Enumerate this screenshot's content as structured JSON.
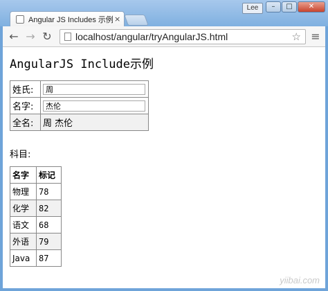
{
  "browser": {
    "tab_title": "Angular JS Includes 示例",
    "tab_close": "×",
    "user_badge": "Lee",
    "url": "localhost/angular/tryAngularJS.html"
  },
  "page": {
    "title": "AngularJS Include示例",
    "form": {
      "first_name_label": "姓氏:",
      "first_name_value": "周",
      "last_name_label": "名字:",
      "last_name_value": "杰伦",
      "full_name_label": "全名:",
      "full_name_value": "周 杰伦"
    },
    "subjects_label": "科目:",
    "subjects_table": {
      "headers": [
        "名字",
        "标记"
      ],
      "rows": [
        {
          "name": "物理",
          "marks": "78"
        },
        {
          "name": "化学",
          "marks": "82"
        },
        {
          "name": "语文",
          "marks": "68"
        },
        {
          "name": "外语",
          "marks": "79"
        },
        {
          "name": "Java",
          "marks": "87"
        }
      ]
    },
    "watermark": "yiibai.com"
  }
}
